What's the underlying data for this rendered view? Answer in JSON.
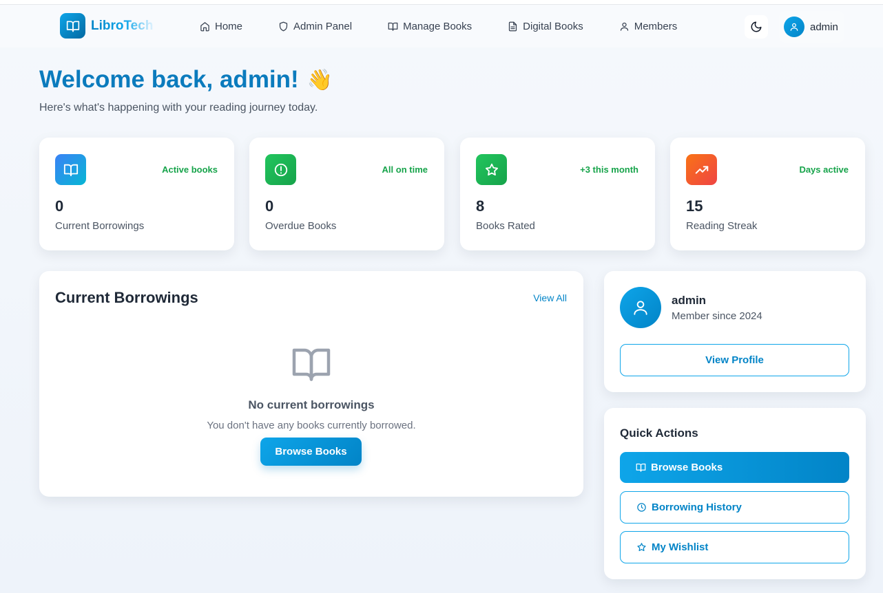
{
  "header": {
    "brand": "LibroTech",
    "nav": [
      {
        "label": "Home",
        "icon": "home-icon"
      },
      {
        "label": "Admin Panel",
        "icon": "shield-icon"
      },
      {
        "label": "Manage Books",
        "icon": "book-open-icon"
      },
      {
        "label": "Digital Books",
        "icon": "document-icon"
      },
      {
        "label": "Members",
        "icon": "user-icon"
      }
    ],
    "theme_icon": "moon-icon",
    "user": "admin"
  },
  "welcome": {
    "title": "Welcome back, admin!",
    "emoji": "👋",
    "subtitle": "Here's what's happening with your reading journey today."
  },
  "stats": [
    {
      "value": "0",
      "label": "Current Borrowings",
      "tag": "Active books",
      "icon": "book-open-icon",
      "color": "#0ea5e9"
    },
    {
      "value": "0",
      "label": "Overdue Books",
      "tag": "All on time",
      "icon": "alert-circle-icon",
      "color": "#22c55e"
    },
    {
      "value": "8",
      "label": "Books Rated",
      "tag": "+3 this month",
      "icon": "star-icon",
      "color": "#22c55e"
    },
    {
      "value": "15",
      "label": "Reading Streak",
      "tag": "Days active",
      "icon": "trending-up-icon",
      "color": "#f97316"
    }
  ],
  "borrowings": {
    "title": "Current Borrowings",
    "view_all": "View All",
    "empty_title": "No current borrowings",
    "empty_text": "You don't have any books currently borrowed.",
    "browse_button": "Browse Books"
  },
  "profile": {
    "name": "admin",
    "member_since": "Member since 2024",
    "view_profile": "View Profile"
  },
  "quick_actions": {
    "title": "Quick Actions",
    "items": [
      {
        "label": "Browse Books",
        "icon": "book-open-icon"
      },
      {
        "label": "Borrowing History",
        "icon": "clock-icon"
      },
      {
        "label": "My Wishlist",
        "icon": "star-icon"
      }
    ]
  }
}
